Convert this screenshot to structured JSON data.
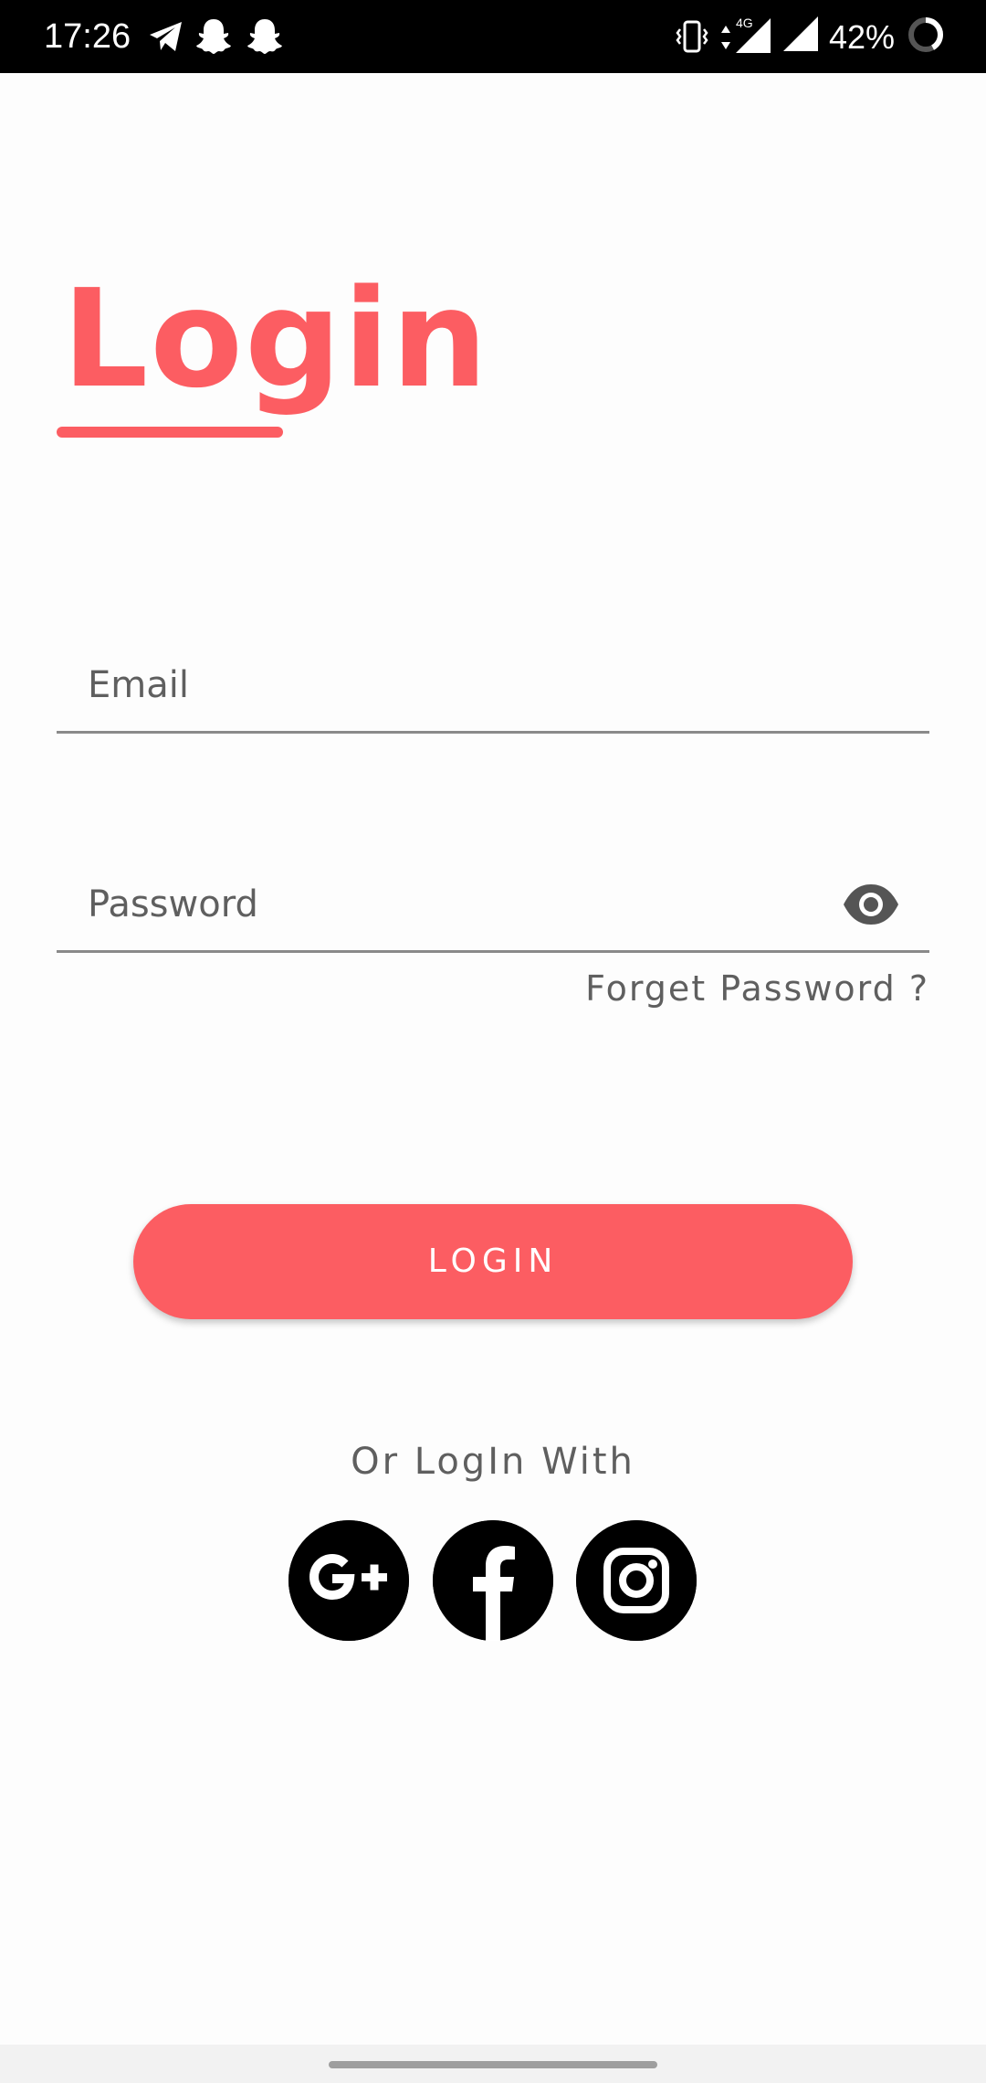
{
  "status_bar": {
    "time": "17:26",
    "battery_percent": "42%",
    "icons": [
      "telegram-icon",
      "snapchat-icon",
      "snapchat-icon",
      "vibrate-icon",
      "data-arrows-icon",
      "signal-4g-icon",
      "signal-icon",
      "battery-ring-icon"
    ],
    "network_label": "4G",
    "battery_level": 0.42
  },
  "title": "Login",
  "colors": {
    "accent": "#fc5d62",
    "status_bar": "#000000",
    "text_muted": "#5f5f5f",
    "field_line": "#8a8a8a",
    "background": "#fdfdfd"
  },
  "form": {
    "email": {
      "value": "",
      "placeholder": "Email"
    },
    "password": {
      "value": "",
      "placeholder": "Password",
      "toggle_icon": "eye-icon"
    },
    "forget_password": "Forget Password ?",
    "login_button": "LOGIN"
  },
  "social": {
    "caption": "Or LogIn With",
    "providers": [
      {
        "name": "Google Plus",
        "icon": "google-plus-icon"
      },
      {
        "name": "Facebook",
        "icon": "facebook-icon"
      },
      {
        "name": "Instagram",
        "icon": "instagram-icon"
      }
    ]
  }
}
